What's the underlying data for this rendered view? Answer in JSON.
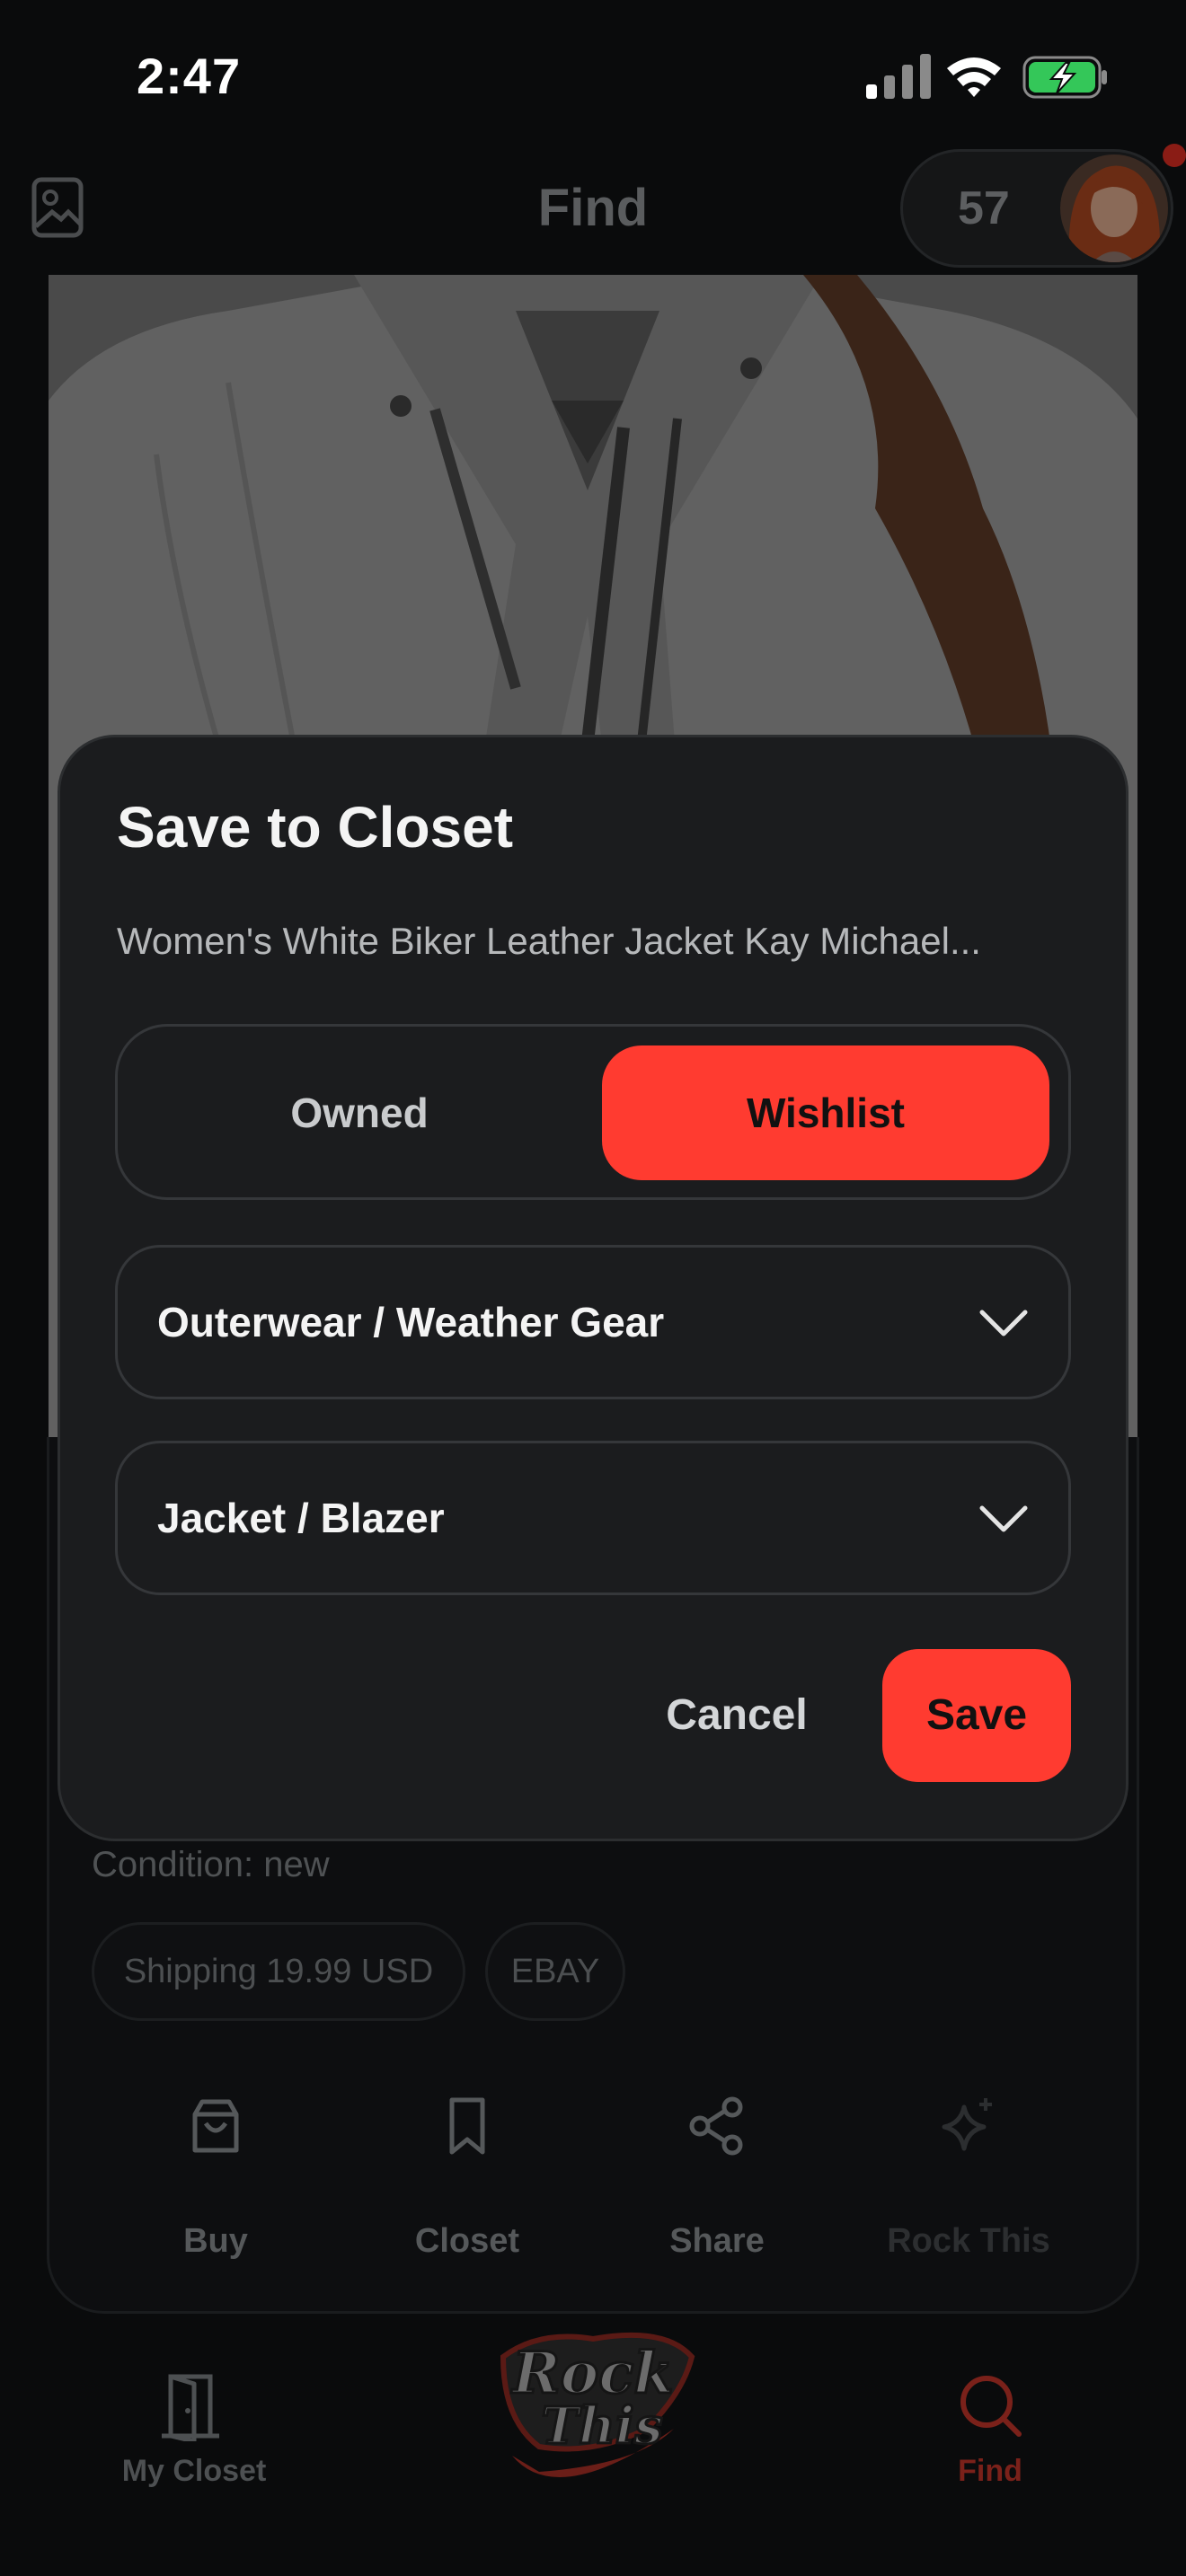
{
  "status_bar": {
    "time": "2:47"
  },
  "header": {
    "title": "Find",
    "count": "57"
  },
  "product": {
    "condition": "Condition: new",
    "chips": [
      "Shipping 19.99 USD",
      "EBAY"
    ],
    "actions": {
      "buy": "Buy",
      "closet": "Closet",
      "share": "Share",
      "rock_this": "Rock This"
    }
  },
  "modal": {
    "title": "Save to Closet",
    "subtitle": "Women's White Biker Leather Jacket Kay Michael...",
    "segment": {
      "owned": "Owned",
      "wishlist": "Wishlist",
      "selected": "Wishlist"
    },
    "category": "Outerwear / Weather Gear",
    "subcategory": "Jacket / Blazer",
    "cancel_label": "Cancel",
    "save_label": "Save"
  },
  "bottom_nav": {
    "my_closet": "My Closet",
    "find": "Find",
    "active": "Find"
  },
  "colors": {
    "accent": "#ff3b30",
    "background": "#0a0b0c",
    "modal": "#1b1c1e"
  },
  "icons": {
    "gallery": "photo-gallery-icon",
    "bag": "shopping-bag-icon",
    "bookmark": "bookmark-icon",
    "share": "share-icon",
    "sparkle": "sparkle-icon",
    "closet": "closet-door-icon",
    "search": "search-icon",
    "chevron": "chevron-down-icon"
  }
}
